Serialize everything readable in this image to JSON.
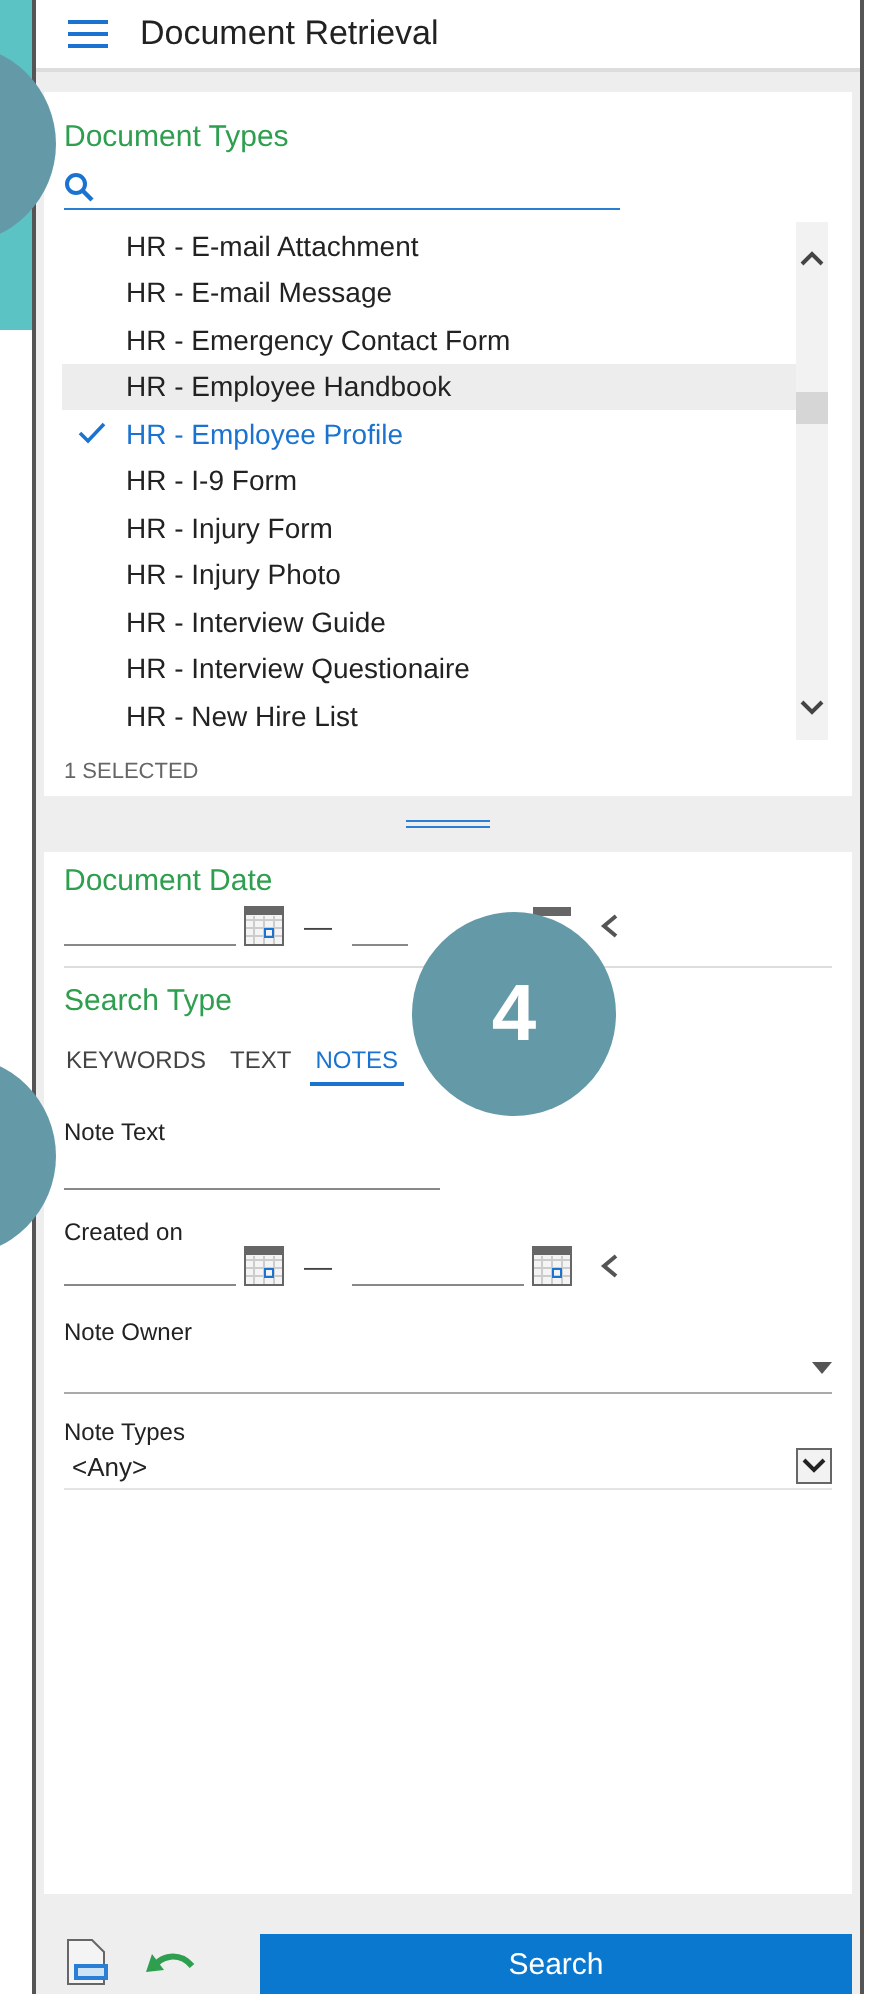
{
  "header": {
    "title": "Document Retrieval"
  },
  "document_types": {
    "heading": "Document Types",
    "items": [
      {
        "label": "HR - E-mail Attachment",
        "selected": false,
        "highlighted": false
      },
      {
        "label": "HR - E-mail Message",
        "selected": false,
        "highlighted": false
      },
      {
        "label": "HR - Emergency Contact Form",
        "selected": false,
        "highlighted": false
      },
      {
        "label": "HR - Employee Handbook",
        "selected": false,
        "highlighted": true
      },
      {
        "label": "HR - Employee Profile",
        "selected": true,
        "highlighted": false
      },
      {
        "label": "HR - I-9 Form",
        "selected": false,
        "highlighted": false
      },
      {
        "label": "HR - Injury Form",
        "selected": false,
        "highlighted": false
      },
      {
        "label": "HR - Injury Photo",
        "selected": false,
        "highlighted": false
      },
      {
        "label": "HR - Interview Guide",
        "selected": false,
        "highlighted": false
      },
      {
        "label": "HR - Interview Questionaire",
        "selected": false,
        "highlighted": false
      },
      {
        "label": "HR - New Hire List",
        "selected": false,
        "highlighted": false
      }
    ],
    "selected_count": "1 SELECTED"
  },
  "document_date": {
    "heading": "Document Date",
    "separator": "—"
  },
  "search_type": {
    "heading": "Search Type",
    "tabs": [
      {
        "label": "KEYWORDS",
        "selected": false
      },
      {
        "label": "TEXT",
        "selected": false
      },
      {
        "label": "NOTES",
        "selected": true
      }
    ]
  },
  "note_fields": {
    "note_text_label": "Note Text",
    "created_on_label": "Created on",
    "created_separator": "—",
    "note_owner_label": "Note Owner",
    "note_types_label": "Note Types",
    "note_types_value": "<Any>"
  },
  "footer": {
    "search_button": "Search"
  },
  "callout": {
    "label": "4"
  }
}
